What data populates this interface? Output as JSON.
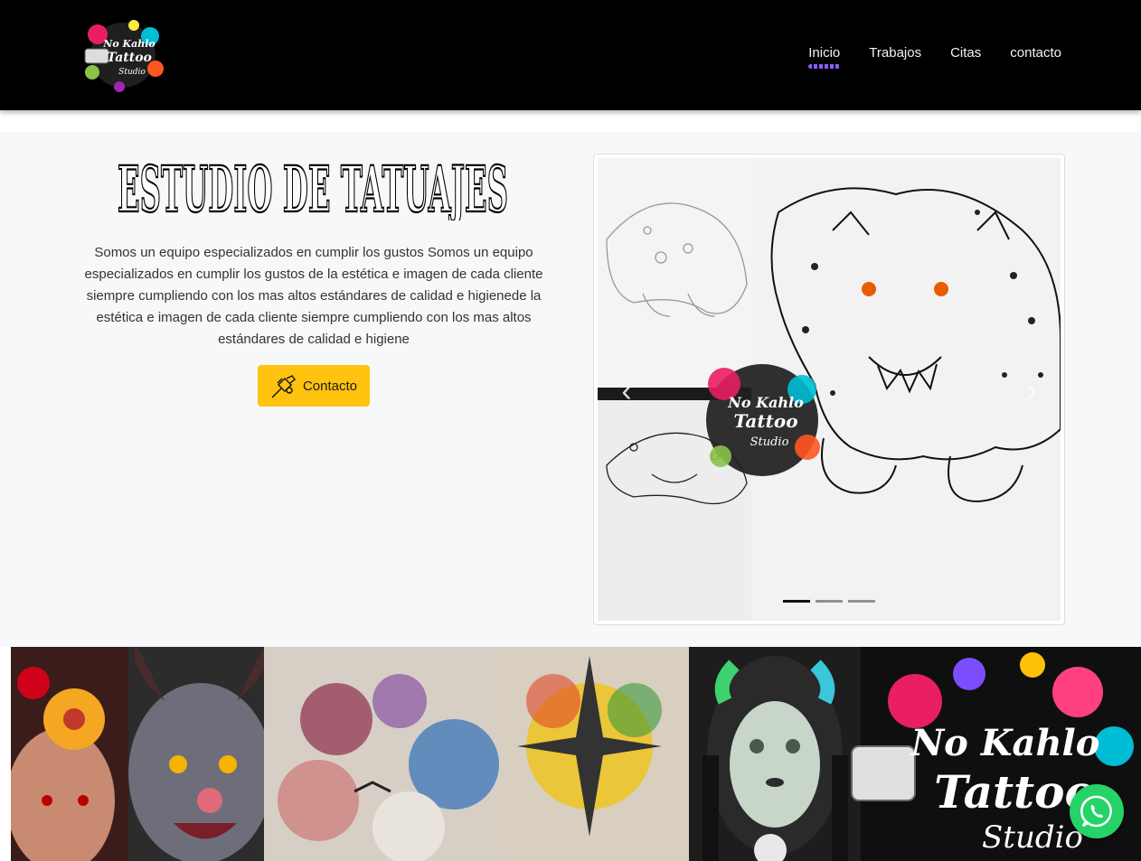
{
  "brand": {
    "logo_lines": [
      "No Kahlo",
      "Tattoo",
      "Studio"
    ]
  },
  "nav": {
    "items": [
      {
        "label": "Inicio",
        "active": true
      },
      {
        "label": "Trabajos",
        "active": false
      },
      {
        "label": "Citas",
        "active": false
      },
      {
        "label": "contacto",
        "active": false
      }
    ],
    "accent": "#8b5cf6"
  },
  "hero": {
    "title": "ESTUDIO DE TATUAJES",
    "text": "Somos un equipo especializados en cumplir los gustos Somos un equipo especializados en cumplir los gustos de la estética e imagen de cada cliente siempre cumpliendo con los mas altos estándares de calidad e higienede la estética e imagen de cada cliente siempre cumpliendo con los mas altos estándares de calidad e higiene",
    "cta_label": "Contacto",
    "cta_icon": "tattoo-machine-icon",
    "cta_color": "#ffc20e",
    "background": "#f7f8fa"
  },
  "carousel": {
    "slide_count": 3,
    "active_slide": 1,
    "prev_icon": "chevron-left-icon",
    "next_icon": "chevron-right-icon",
    "prev_glyph": "‹",
    "next_glyph": "›",
    "watermark_lines": [
      "No Kahlo",
      "Tattoo",
      "Studio"
    ]
  },
  "banner": {
    "logo_lines": [
      "No Kahlo",
      "Tattoo",
      "Studio"
    ]
  },
  "whatsapp": {
    "icon": "whatsapp-icon",
    "color": "#25d366"
  }
}
